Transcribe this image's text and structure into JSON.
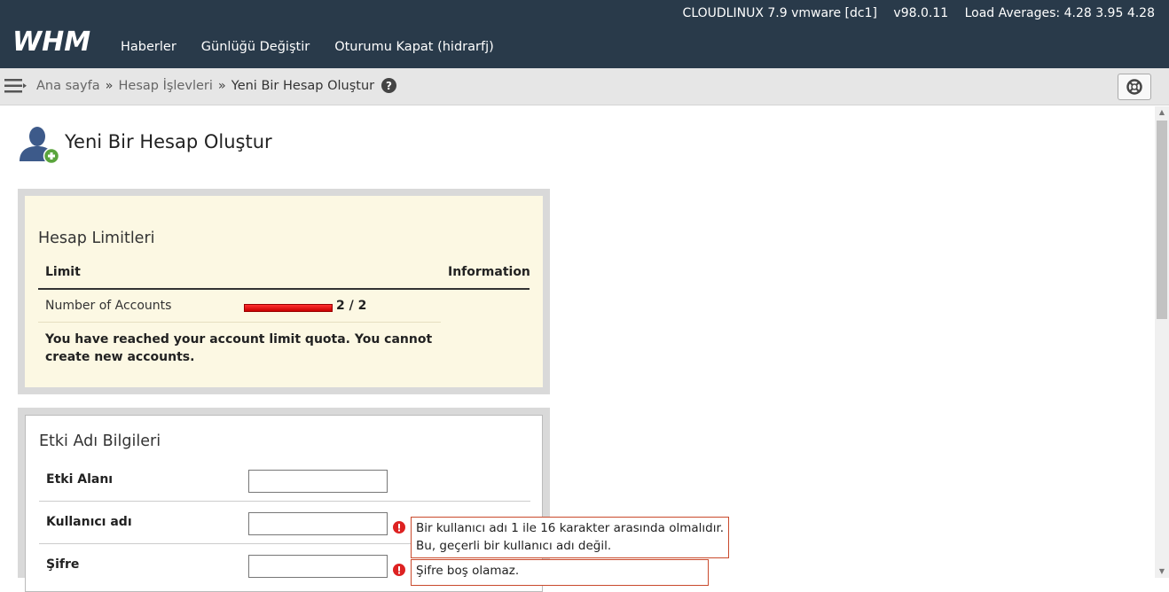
{
  "header": {
    "server": "CLOUDLINUX 7.9 vmware [dc1]",
    "version": "v98.0.11",
    "load": "Load Averages: 4.28 3.95 4.28",
    "logo_text": "WHM",
    "nav": [
      "Haberler",
      "Günlüğü Değiştir",
      "Oturumu Kapat (hidrarfj)"
    ]
  },
  "breadcrumb": {
    "home": "Ana sayfa",
    "sep": "»",
    "section": "Hesap İşlevleri",
    "current": "Yeni Bir Hesap Oluştur"
  },
  "page": {
    "title": "Yeni Bir Hesap Oluştur"
  },
  "limits": {
    "title": "Hesap Limitleri",
    "col_limit": "Limit",
    "col_info": "Information",
    "row_label": "Number of Accounts",
    "usage": "2 / 2",
    "usage_fraction": 1.0,
    "message": "You have reached your account limit quota. You cannot create new accounts."
  },
  "domain_info": {
    "title": "Etki Adı Bilgileri",
    "fields": [
      {
        "label": "Etki Alanı",
        "value": ""
      },
      {
        "label": "Kullanıcı adı",
        "value": "",
        "error": [
          "Bir kullanıcı adı 1 ile 16 karakter arasında olmalıdır.",
          "Bu, geçerli bir kullanıcı adı değil."
        ]
      },
      {
        "label": "Şifre",
        "value": "",
        "error": [
          "Şifre boş olamaz."
        ]
      }
    ]
  },
  "colors": {
    "header": "#293a4a",
    "limits_bg": "#fcf8e3",
    "error": "#c94a2c",
    "quota_bar": "#e00000"
  }
}
